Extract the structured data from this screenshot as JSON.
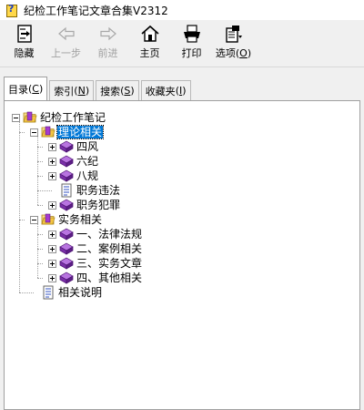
{
  "window": {
    "title": "纪检工作笔记文章合集V2312"
  },
  "toolbar": {
    "buttons": [
      {
        "label": "隐藏",
        "icon": "hide-panel-icon",
        "enabled": true
      },
      {
        "label": "上一步",
        "icon": "back-arrow-icon",
        "enabled": false
      },
      {
        "label": "前进",
        "icon": "forward-arrow-icon",
        "enabled": false
      },
      {
        "label": "主页",
        "icon": "home-icon",
        "enabled": true
      },
      {
        "label": "打印",
        "icon": "printer-icon",
        "enabled": true
      },
      {
        "label": "选项",
        "mnemonic": "O",
        "icon": "options-icon",
        "enabled": true
      }
    ]
  },
  "tabs": [
    {
      "label": "目录",
      "mnemonic": "C",
      "active": true
    },
    {
      "label": "索引",
      "mnemonic": "N",
      "active": false
    },
    {
      "label": "搜索",
      "mnemonic": "S",
      "active": false
    },
    {
      "label": "收藏夹",
      "mnemonic": "I",
      "active": false
    }
  ],
  "tree": {
    "root": {
      "label": "纪检工作笔记"
    },
    "groups": [
      {
        "label": "理论相关",
        "selected": true,
        "children": [
          {
            "label": "四风",
            "type": "book"
          },
          {
            "label": "六纪",
            "type": "book"
          },
          {
            "label": "八规",
            "type": "book"
          },
          {
            "label": "职务违法",
            "type": "page"
          },
          {
            "label": "职务犯罪",
            "type": "book"
          }
        ]
      },
      {
        "label": "实务相关",
        "selected": false,
        "children": [
          {
            "label": "一、法律法规",
            "type": "book"
          },
          {
            "label": "二、案例相关",
            "type": "book"
          },
          {
            "label": "三、实务文章",
            "type": "book"
          },
          {
            "label": "四、其他相关",
            "type": "book"
          }
        ]
      }
    ],
    "trailing": {
      "label": "相关说明",
      "type": "page"
    }
  },
  "colors": {
    "selection": "#0078d7",
    "book_purple": "#7a2fa8",
    "folder_yellow": "#f4c542"
  }
}
